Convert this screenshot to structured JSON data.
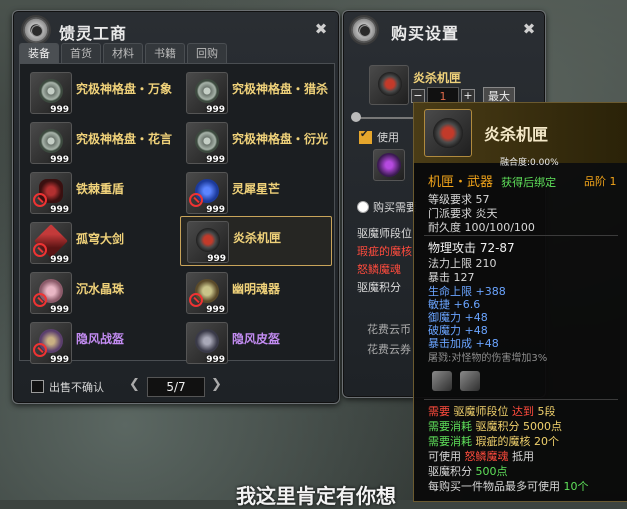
{
  "left_panel": {
    "title": "馈灵工商",
    "tabs": [
      {
        "label": "装备"
      },
      {
        "label": "首货"
      },
      {
        "label": "材料"
      },
      {
        "label": "书籍"
      },
      {
        "label": "回购"
      }
    ],
    "items": [
      {
        "name": "究极神格盘・万象",
        "count": "999",
        "color": "yellow",
        "icon": "rune-disc-icon",
        "locked": false
      },
      {
        "name": "究极神格盘・猎杀",
        "count": "999",
        "color": "yellow",
        "icon": "rune-disc-icon",
        "locked": false
      },
      {
        "name": "究极神格盘・花言",
        "count": "999",
        "color": "yellow",
        "icon": "rune-disc-icon",
        "locked": false
      },
      {
        "name": "究极神格盘・衍光",
        "count": "999",
        "color": "yellow",
        "icon": "rune-disc-icon",
        "locked": false
      },
      {
        "name": "铁棘重盾",
        "count": "999",
        "color": "yellow",
        "icon": "shield-icon",
        "locked": true
      },
      {
        "name": "灵犀星芒",
        "count": "999",
        "color": "yellow",
        "icon": "star-disc-icon",
        "locked": true
      },
      {
        "name": "孤穹大剑",
        "count": "999",
        "color": "yellow",
        "icon": "greatsword-icon",
        "locked": true
      },
      {
        "name": "炎杀机匣",
        "count": "999",
        "color": "yellow",
        "icon": "gauntlet-icon",
        "locked": false
      },
      {
        "name": "沉水晶珠",
        "count": "999",
        "color": "yellow",
        "icon": "crystal-orb-icon",
        "locked": true
      },
      {
        "name": "幽明魂器",
        "count": "999",
        "color": "yellow",
        "icon": "soul-vessel-icon",
        "locked": true
      },
      {
        "name": "隐风战盔",
        "count": "999",
        "color": "purple",
        "icon": "helmet-icon",
        "locked": true
      },
      {
        "name": "隐风皮盔",
        "count": "999",
        "color": "purple",
        "icon": "leather-helm-icon",
        "locked": false
      }
    ],
    "footer": {
      "no_confirm_label": "出售不确认",
      "page": "5/7"
    }
  },
  "right_panel": {
    "title": "购买设置",
    "item_name": "炎杀机匣",
    "quantity": "1",
    "max_label": "最大",
    "use_label": "使用",
    "buy_need_label": "购买需要",
    "req_lines": [
      {
        "label": "驱魔师段位",
        "color": "#dcdcdc"
      },
      {
        "label": "瑕疵的魔核",
        "color": "#ff4b3d"
      },
      {
        "label": "怒鳞魔魂",
        "color": "#ff4b3d"
      },
      {
        "label": "驱魔积分",
        "color": "#dcdcdc"
      }
    ],
    "cost_label_1": "花费云币",
    "cost_label_2": "花费云券"
  },
  "tooltip": {
    "title": "炎杀机匣",
    "fusion": "融合度:0.00%",
    "type": "机匣・武器",
    "bind": "获得后绑定",
    "quality_label": "品阶",
    "quality_value": "1",
    "level_req": "等级要求  57",
    "school_req": "门派要求  炎天",
    "durability": "耐久度   100/100/100",
    "atk": "物理攻击  72-87",
    "mp": "法力上限  210",
    "crit": "暴击  127",
    "bonuses": [
      {
        "text": "生命上限 +388",
        "color": "blue"
      },
      {
        "text": "敏捷 +6.6",
        "color": "blue"
      },
      {
        "text": "御魔力 +48",
        "color": "blue"
      },
      {
        "text": "破魔力 +48",
        "color": "blue"
      },
      {
        "text": "暴击加成 +48",
        "color": "blue"
      }
    ],
    "monster_bonus": "屠戮:对怪物的伤害增加3%",
    "need1_a": "需要",
    "need1_b": "驱魔师段位",
    "need1_c": "达到",
    "need1_d": "5段",
    "need2_a": "需要消耗",
    "need2_b": "驱魔积分",
    "need2_c": "5000点",
    "need3_a": "需要消耗",
    "need3_b": "瑕疵的魔核",
    "need3_c": "20个",
    "need4_a": "可使用",
    "need4_b": "怒鳞魔魂",
    "need4_c": "抵用",
    "score_label": "驱魔积分",
    "score_value": "500点",
    "limit_a": "每购买一件物品最多可使用",
    "limit_b": "10个"
  },
  "bottom_text": "我这里肯定有你想"
}
